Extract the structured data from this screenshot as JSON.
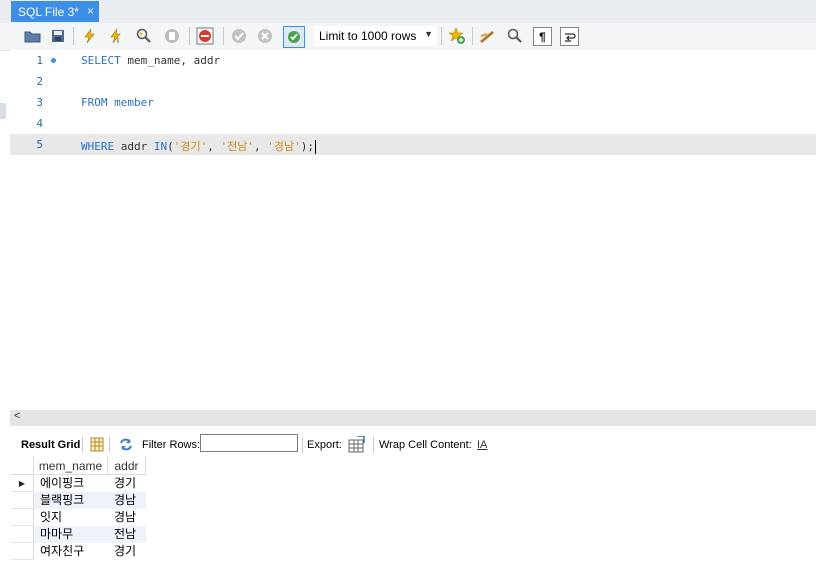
{
  "tab": {
    "title": "SQL File 3*",
    "close_glyph": "×"
  },
  "toolbar": {
    "icons": [
      "open-folder-icon",
      "save-icon",
      "execute-icon",
      "execute-current-icon",
      "explain-icon",
      "stop-icon",
      "toggle-error-stop-icon",
      "commit-icon",
      "rollback-icon",
      "autocommit-icon",
      "add-snippet-icon",
      "beautify-icon",
      "find-icon",
      "invisibles-icon",
      "wrap-lines-icon"
    ],
    "limit_label": "Limit to 1000 rows",
    "limit_arrow": "▼"
  },
  "editor": {
    "lines": [
      {
        "num": "1",
        "code": "SELECT mem_name, addr"
      },
      {
        "num": "2",
        "code": ""
      },
      {
        "num": "3",
        "code": "FROM member"
      },
      {
        "num": "4",
        "code": ""
      },
      {
        "num": "5",
        "code": "WHERE addr IN('경기', '전남', '경남');"
      }
    ],
    "line1": {
      "kw": "SELECT",
      "rest": " mem_name, addr"
    },
    "line3": {
      "kw": "FROM",
      "rest": " member"
    },
    "line5": {
      "kw1": "WHERE",
      "mid1": " addr ",
      "kw2": "IN",
      "p1": "(",
      "s1": "'경기'",
      "c1": ", ",
      "s2": "'전남'",
      "c2": ", ",
      "s3": "'경남'",
      "end": ");"
    }
  },
  "scrollbar": {
    "left_arrow": "<"
  },
  "results_toolbar": {
    "result_grid": "Result Grid",
    "filter_rows": "Filter Rows:",
    "filter_value": "",
    "export": "Export:",
    "wrap_cell": "Wrap Cell Content:",
    "wrap_icon_glyph": "IA"
  },
  "grid": {
    "columns": [
      "mem_name",
      "addr"
    ],
    "rows": [
      [
        "에이핑크",
        "경기"
      ],
      [
        "블랙핑크",
        "경남"
      ],
      [
        "잇지",
        "경남"
      ],
      [
        "마마무",
        "전남"
      ],
      [
        "여자친구",
        "경기"
      ]
    ],
    "row_pointer": "▶"
  }
}
